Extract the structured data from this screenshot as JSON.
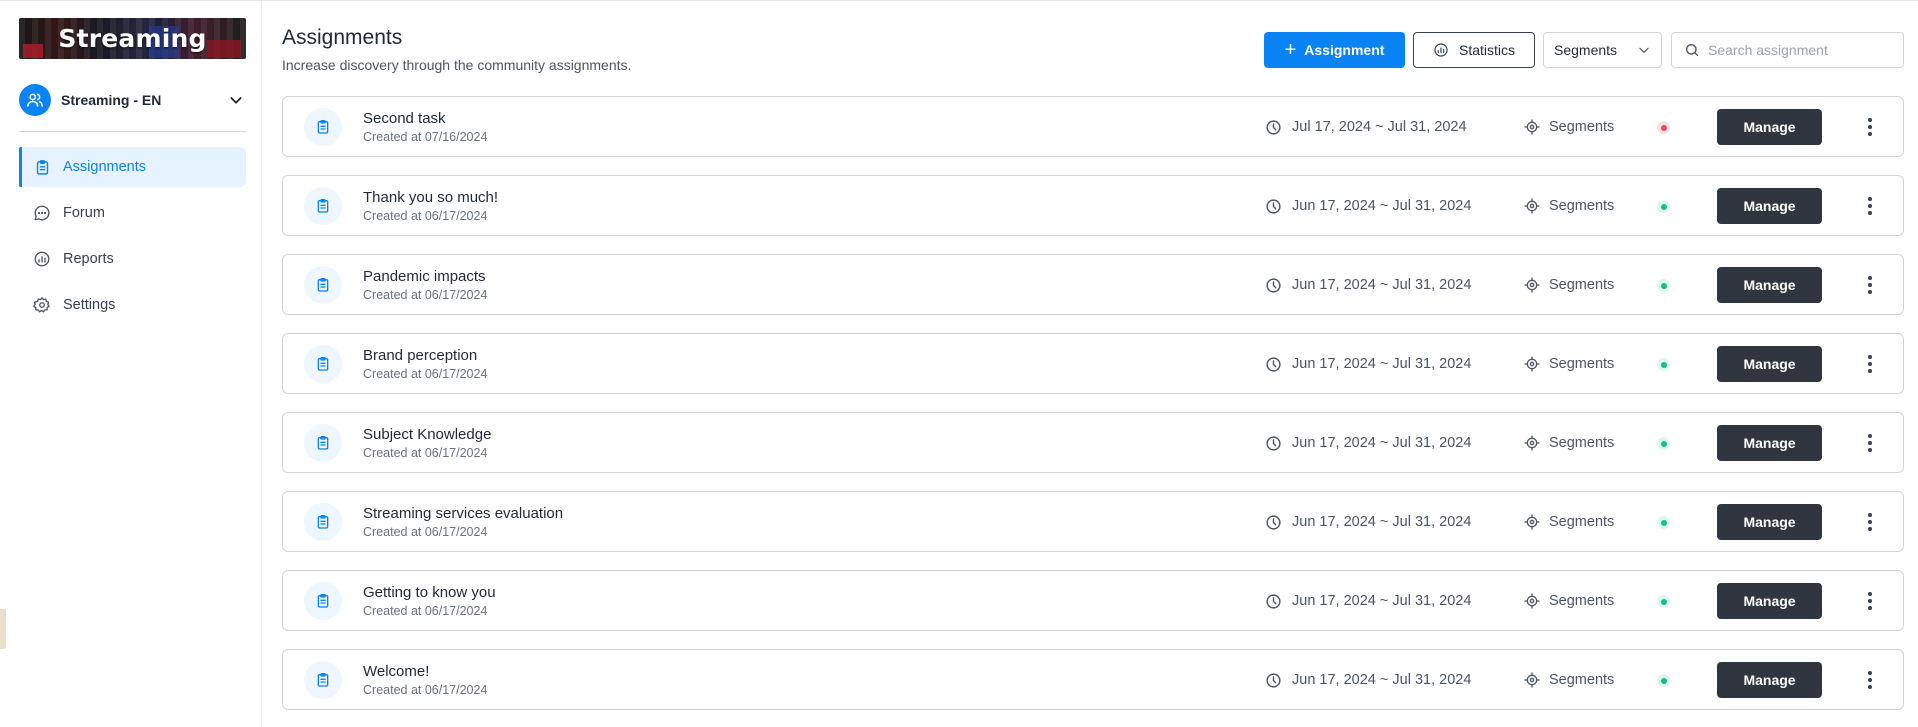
{
  "sidebar": {
    "logo_text": "Streaming",
    "community_name": "Streaming - EN",
    "nav": [
      {
        "label": "Assignments",
        "icon": "clipboard-icon",
        "active": true
      },
      {
        "label": "Forum",
        "icon": "chat-bubble-icon",
        "active": false
      },
      {
        "label": "Reports",
        "icon": "pie-chart-icon",
        "active": false
      },
      {
        "label": "Settings",
        "icon": "gear-icon",
        "active": false
      }
    ]
  },
  "header": {
    "title": "Assignments",
    "subtitle": "Increase discovery through the community assignments.",
    "add_button_label": "Assignment",
    "statistics_label": "Statistics",
    "segments_select_value": "Segments",
    "search_placeholder": "Search assignment",
    "search_value": ""
  },
  "colors": {
    "primary": "#0a84f5",
    "manage_button": "#2f3640",
    "status_active": "#10c08a",
    "status_inactive": "#f04a5e"
  },
  "assignments": [
    {
      "name": "Second task",
      "created": "Created at 07/16/2024",
      "period": "Jul 17, 2024 ~ Jul 31, 2024",
      "segments": "Segments",
      "status": "inactive",
      "action": "Manage"
    },
    {
      "name": "Thank you so much!",
      "created": "Created at 06/17/2024",
      "period": "Jun 17, 2024 ~ Jul 31, 2024",
      "segments": "Segments",
      "status": "active",
      "action": "Manage"
    },
    {
      "name": "Pandemic impacts",
      "created": "Created at 06/17/2024",
      "period": "Jun 17, 2024 ~ Jul 31, 2024",
      "segments": "Segments",
      "status": "active",
      "action": "Manage"
    },
    {
      "name": "Brand perception",
      "created": "Created at 06/17/2024",
      "period": "Jun 17, 2024 ~ Jul 31, 2024",
      "segments": "Segments",
      "status": "active",
      "action": "Manage"
    },
    {
      "name": "Subject Knowledge",
      "created": "Created at 06/17/2024",
      "period": "Jun 17, 2024 ~ Jul 31, 2024",
      "segments": "Segments",
      "status": "active",
      "action": "Manage"
    },
    {
      "name": "Streaming services evaluation",
      "created": "Created at 06/17/2024",
      "period": "Jun 17, 2024 ~ Jul 31, 2024",
      "segments": "Segments",
      "status": "active",
      "action": "Manage"
    },
    {
      "name": "Getting to know you",
      "created": "Created at 06/17/2024",
      "period": "Jun 17, 2024 ~ Jul 31, 2024",
      "segments": "Segments",
      "status": "active",
      "action": "Manage"
    },
    {
      "name": "Welcome!",
      "created": "Created at 06/17/2024",
      "period": "Jun 17, 2024 ~ Jul 31, 2024",
      "segments": "Segments",
      "status": "active",
      "action": "Manage"
    }
  ]
}
